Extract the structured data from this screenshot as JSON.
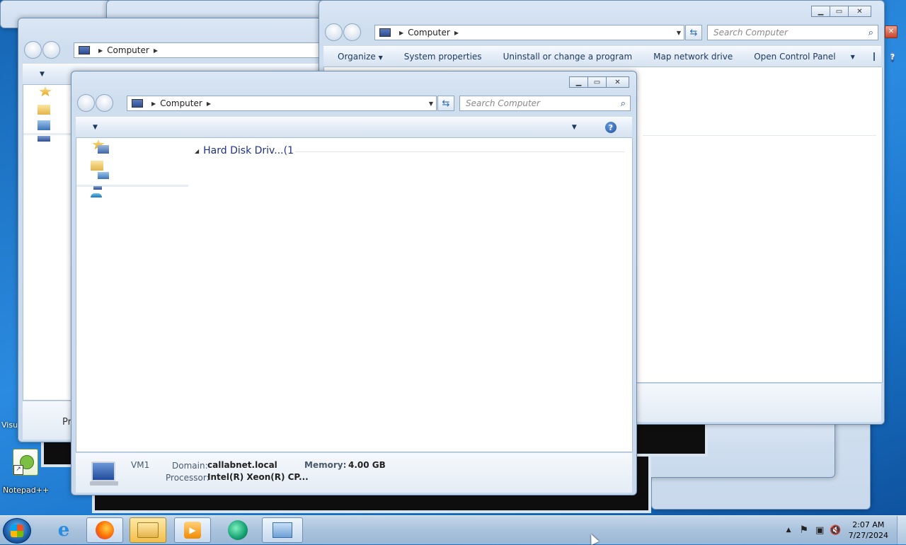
{
  "desktop": {
    "icons": [
      {
        "label": "Notepad++"
      },
      {
        "label": "Visu"
      }
    ]
  },
  "window_back_left": {
    "address": {
      "location": "Computer"
    },
    "status": {
      "text": "Pr"
    }
  },
  "window_back_right": {
    "address": {
      "location": "Computer"
    },
    "search": {
      "placeholder": "Search Computer"
    },
    "toolbar": {
      "items": [
        "Organize",
        "System properties",
        "Uninstall or change a program",
        "Map network drive",
        "Open Control Panel"
      ]
    }
  },
  "window_front": {
    "address": {
      "location": "Computer"
    },
    "search": {
      "placeholder": "Search Computer"
    },
    "content": {
      "group_header": "Hard Disk Driv...(1"
    },
    "details": {
      "computer_name": "VM1",
      "domain_label": "Domain:",
      "domain_value": "callabnet.local",
      "memory_label": "Memory:",
      "memory_value": "4.00 GB",
      "processor_label": "Processor:",
      "processor_value": "Intel(R) Xeon(R) CP..."
    }
  },
  "taskbar": {
    "clock": {
      "time": "2:07 AM",
      "date": "7/27/2024"
    }
  }
}
